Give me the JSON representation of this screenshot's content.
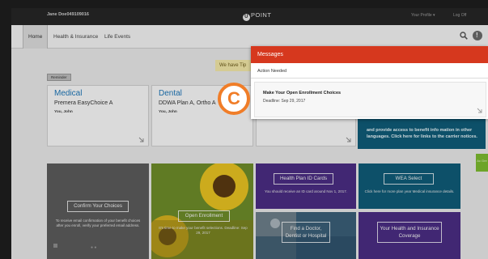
{
  "topbar": {
    "user_name": "Jane Doe049109016",
    "logo_text": "POINT",
    "logo_mark": "U",
    "profile_label": "Your Profile ▾",
    "logoff_label": "Log Off"
  },
  "nav": {
    "tabs": [
      {
        "label": "Home"
      },
      {
        "label": "Health & Insurance"
      },
      {
        "label": "Life Events"
      }
    ]
  },
  "banner": {
    "text": "We have Tip"
  },
  "reminder": {
    "text": "Reminder"
  },
  "cards": [
    {
      "title": "Medical",
      "plan": "Premera EasyChoice A",
      "who": "You, John"
    },
    {
      "title": "Dental",
      "plan": "DDWA Plan A, Ortho A",
      "who": "You, John"
    }
  ],
  "teal_card": {
    "text": "and provide access to benefit info mation in other languages. Click here for links to the carrier notices."
  },
  "green_side": {
    "text": "Ac Gre"
  },
  "tiles": [
    {
      "button": "Confirm Your Choices",
      "desc": "To receive email confirmation of your benefit choices after you enroll, verify your preferred email address.",
      "color": "#5c5c5c"
    },
    {
      "button": "Open Enrollment",
      "desc": "It's time to make your benefit selections. Deadline: Sep 29, 2017",
      "color": "#b8a11e"
    },
    {
      "button": "Health Plan ID Cards",
      "desc": "You should receive an ID card around Nov 1, 2017.",
      "color": "#4a2d83"
    },
    {
      "button": "WEA Select",
      "desc": "Click here for more plan year Medical insurance details.",
      "color": "#0f5c78"
    },
    {
      "button": "Find a Doctor, Dentist or Hospital",
      "desc": "",
      "color": "#2a4d68"
    },
    {
      "button": "Your Health and Insurance Coverage",
      "desc": "",
      "color": "#4a2d83"
    }
  ],
  "messages": {
    "header": "Messages",
    "section": "Action Needed",
    "item_title": "Make Your Open Enrollment Choices",
    "item_deadline": "Deadline: Sep 29, 2017"
  },
  "badge": {
    "letter": "C"
  },
  "colors": {
    "accent": "#d6381e",
    "badge": "#f07d28",
    "link": "#1d76b8"
  }
}
